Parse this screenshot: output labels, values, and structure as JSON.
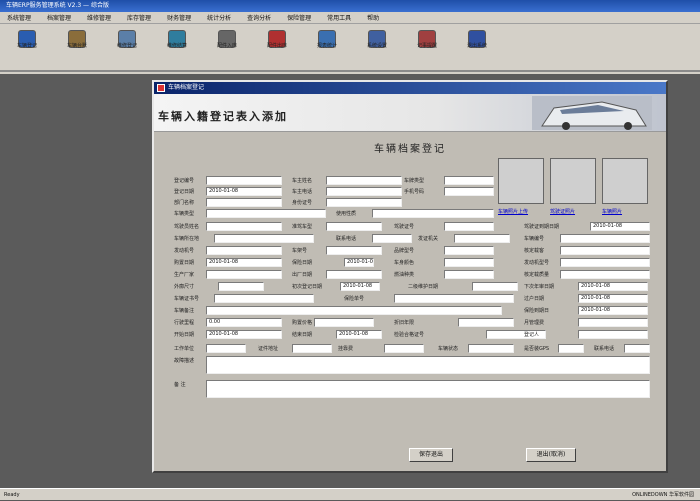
{
  "app": {
    "title": "车辆ERP服务管理系统 V2.3 — 综合版",
    "menu": [
      "系统管理",
      "档案管理",
      "维修管理",
      "库存管理",
      "财务管理",
      "统计分析",
      "查询分析",
      "保险管理",
      "常用工具",
      "帮助"
    ],
    "toolbar": [
      {
        "label": "车辆登记",
        "color": "#2a5db0"
      },
      {
        "label": "车辆台账",
        "color": "#8a6d3b"
      },
      {
        "label": "维修登记",
        "color": "#5b7fa8"
      },
      {
        "label": "维修结算",
        "color": "#2f7d9e"
      },
      {
        "label": "配件入库",
        "color": "#666666"
      },
      {
        "label": "配件出库",
        "color": "#b03030"
      },
      {
        "label": "报表统计",
        "color": "#3a6fb0"
      },
      {
        "label": "系统设置",
        "color": "#4060a0"
      },
      {
        "label": "记事提醒",
        "color": "#a04040"
      },
      {
        "label": "退出系统",
        "color": "#3050a0"
      }
    ],
    "status_left": "Ready",
    "status_right": "ONLINEDOWN 华军软件园"
  },
  "dialog": {
    "title": "车辆档案登记",
    "banner": "车辆入籍登记表入添加",
    "heading": "车辆档案登记",
    "photo_links": [
      "车辆照片上传",
      "驾驶证照片",
      "车辆照片"
    ],
    "labels": {
      "reg_no": "登记编号",
      "reg_date": "登记日期",
      "dept": "部门名称",
      "plate_type": "车牌类型",
      "owner": "车主姓名",
      "owner_phone": "车主电话",
      "mobile": "手机号码",
      "id_no": "身份证号",
      "vehicle_type": "车辆类型",
      "usage": "使用性质",
      "driver": "驾驶员姓名",
      "license_type": "准驾车型",
      "license_no": "驾驶证号",
      "license_expiry": "驾驶证到期日期",
      "vehicle_addr": "车辆所在地",
      "contact": "联系电话",
      "issuer": "发证机关",
      "vehicle_no": "车辆编号",
      "engine_no": "发动机号",
      "frame_no": "车架号",
      "brand": "品牌型号",
      "seats": "核定载客",
      "buy_date": "购置日期",
      "insure_date": "保险日期",
      "body_color": "车身颜色",
      "eng_model": "发动机型号",
      "manufacturer": "生产厂家",
      "made_date": "出厂日期",
      "fuel": "燃油种类",
      "tonnage": "核定载质量",
      "dimensions": "外廓尺寸",
      "first_reg": "初次登记日期",
      "inspect": "二级维护日期",
      "next_inspect": "下次年审日期",
      "cert_no": "车辆证书号",
      "transfer": "过户日期",
      "insurance_no": "保险单号",
      "insure_expiry": "保险到期日",
      "note1": "车辆备注",
      "mileage": "行驶里程",
      "purchase_price": "购置价格",
      "depreciation": "折旧年限",
      "monthly_fee": "月管理费",
      "start_date": "开始日期",
      "end_date": "结束日期",
      "cert_record": "检验合格证号",
      "signup": "登记人",
      "work_unit": "工作单位",
      "addr": "证件地址",
      "reg_fee": "挂靠费",
      "vehicle_state": "车辆状态",
      "gps": "是否装GPS",
      "tel2": "联系电话",
      "fault_desc": "故障描述",
      "remark": "备    注"
    },
    "values": {
      "reg_date": "2010-01-08",
      "license_expiry": "2010-01-08",
      "buy_date": "2010-01-08",
      "insure_date": "2010-01-08",
      "first_reg": "2010-01-08",
      "next_inspect": "2010-01-08",
      "transfer": "2010-01-08",
      "mileage": "0.00",
      "start_date": "2010-01-08",
      "end_date": "2010-01-08",
      "insure_expiry": "2010-01-08"
    },
    "buttons": {
      "save": "保存退出",
      "cancel": "退出(取消)"
    }
  }
}
